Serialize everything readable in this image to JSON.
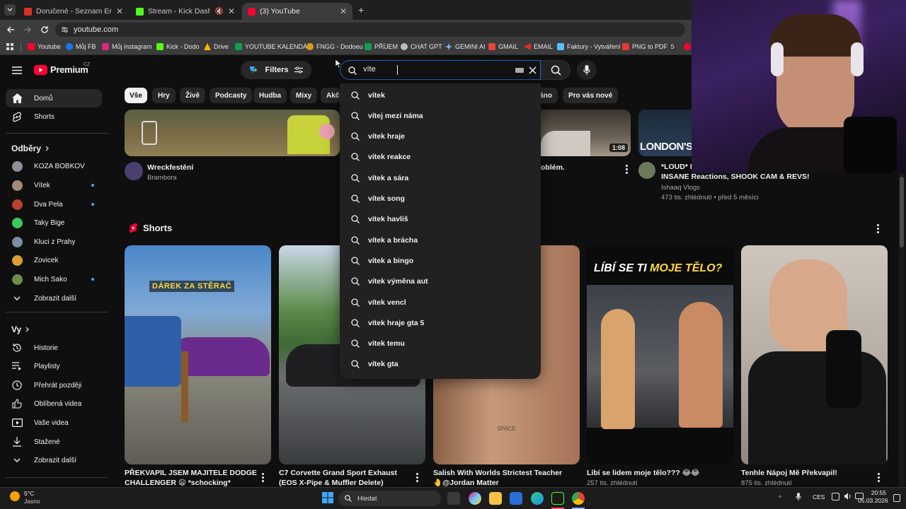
{
  "tabs": [
    {
      "title": "Doručené - Seznam Email",
      "color": "#d93025"
    },
    {
      "title": "Stream - Kick Dashboard",
      "color": "#53fc18"
    },
    {
      "title": "(3) YouTube",
      "color": "#ff0033"
    }
  ],
  "address": {
    "url": "youtube.com"
  },
  "bookmarks": [
    {
      "label": "Youtube",
      "color": "#ff0033"
    },
    {
      "label": "Můj FB",
      "color": "#1877f2"
    },
    {
      "label": "Můj instagram",
      "color": "#d62976"
    },
    {
      "label": "Kick - Dodo",
      "color": "#53fc18"
    },
    {
      "label": "Drive",
      "color": "#fbbc04"
    },
    {
      "label": "YOUTUBE KALENDÁŘ",
      "color": "#0f9d58"
    },
    {
      "label": "FNGG - Dodoeu",
      "color": "#d4a017"
    },
    {
      "label": "PŘÍJEM",
      "color": "#0f9d58"
    },
    {
      "label": "CHAT GPT",
      "color": "#bbbbbb"
    },
    {
      "label": "GEMINI AI",
      "color": "#8ab4f8"
    },
    {
      "label": "GMAIL",
      "color": "#ea4335"
    },
    {
      "label": "EMAIL",
      "color": "#d93025"
    },
    {
      "label": "Faktury - Vytváření",
      "color": "#4fc3f7"
    },
    {
      "label": "PNG to PDF",
      "color": "#e53935"
    },
    {
      "label": "S",
      "color": "#cccccc"
    }
  ],
  "header": {
    "logo_text": "Premium",
    "logo_sup": "CZ",
    "filters_label": "Filters",
    "search_value": "víte"
  },
  "chips": [
    "Vše",
    "Hry",
    "Živě",
    "Podcasty",
    "Hudba",
    "Mixy",
    "Akč",
    "áno",
    "Pro vás nové"
  ],
  "sidebar": {
    "home": "Domů",
    "shorts": "Shorts",
    "subs_title": "Odběry",
    "channels": [
      "KOZA BOBKOV",
      "Vítek",
      "Dva Pela",
      "Taky Bige",
      "Kluci z Prahy",
      "Zovicek",
      "Mich Sako"
    ],
    "show_more_1": "Zobrazit další",
    "you_title": "Vy",
    "you_items": [
      "Historie",
      "Playlisty",
      "Přehrát později",
      "Oblíbená videa",
      "Vaše videa",
      "Stažené",
      "Zobrazit další"
    ]
  },
  "videos": [
    {
      "title": "Wreckfestění",
      "channel": "Brambora"
    },
    {
      "title": "oblém.",
      "duration": "1:08"
    },
    {
      "title_1": "*LOUD* F",
      "title_2": "INSANE Reactions, SHOOK CAM & REVS!",
      "channel": "Ishaaq Vlogs",
      "stats": "473 tis. zhlédnutí • před 5 měsíci",
      "thumb_text": "LONDON'S"
    }
  ],
  "shorts": {
    "heading": "Shorts",
    "items": [
      {
        "title_1": "PŘEKVAPIL JSEM MAJITELE DODGE",
        "title_2": "CHALLENGER 😦 *schocking*",
        "overlay": "DÁREK ZA STĚRAČ"
      },
      {
        "title_1": "C7 Corvette Grand Sport Exhaust",
        "title_2": "(EOS X-Pipe & Muffler Delete)"
      },
      {
        "title_1": "Salish With Worlds Strictest Teacher",
        "title_2": "🤚@Jordan Matter",
        "overlay": "SPACE"
      },
      {
        "title_1": "Líbí se lidem moje tělo??? 😂😂",
        "views": "257 tis. zhlédnutí",
        "overlay_1": "LÍBÍ SE TI ",
        "overlay_2": "MOJE TĚLO?"
      },
      {
        "title_1": "Tenhle Nápoj Mě Překvapil!",
        "views": "875 tis. zhlédnutí"
      }
    ]
  },
  "suggestions": [
    "vítek",
    "vítej mezi náma",
    "vítek hraje",
    "vítek reakce",
    "vítek a sára",
    "vítek song",
    "vítek havliš",
    "vítek a brácha",
    "vítek a bingo",
    "vítek výměna aut",
    "vítek vencl",
    "vítek hraje gta 5",
    "vítek temu",
    "vítek gta"
  ],
  "taskbar": {
    "weather_temp": "5°C",
    "weather_desc": "Jasno",
    "search_placeholder": "Hledat",
    "lang": "CES",
    "time": "20:55",
    "date": "05.03.2026"
  }
}
